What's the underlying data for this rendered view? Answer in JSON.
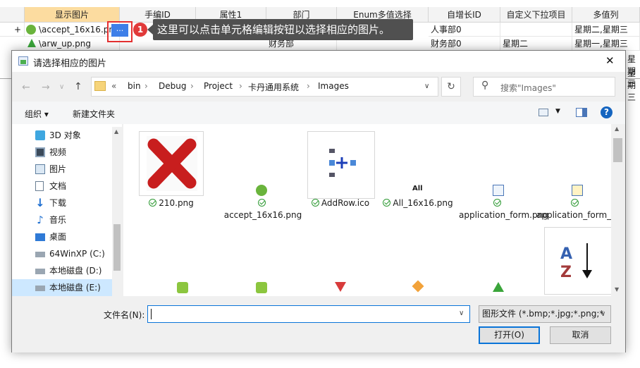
{
  "grid": {
    "headers": [
      "显示图片",
      "手编ID",
      "属性1",
      "部门",
      "Enum多值选择",
      "自增长ID",
      "自定义下拉项目",
      "多值列"
    ],
    "row1": {
      "image_value": "\\accept_16x16.png",
      "ellipsis": "...",
      "dept": "",
      "auto_id": "人事部0",
      "custom": "",
      "multi": "星期二,星期三"
    },
    "row2": {
      "image_value": "\\arw_up.png",
      "dept": "财务部",
      "auto_id": "财务部0",
      "custom": "星期二",
      "multi": "星期一,星期三"
    },
    "row_marker": "+",
    "right_edge": [
      "星期三",
      "星期三"
    ],
    "callout_number": "1",
    "callout_text": "这里可以点击单元格编辑按钮以选择相应的图片。"
  },
  "dialog": {
    "title": "请选择相应的图片",
    "close_symbol": "✕",
    "breadcrumb": {
      "prefix": "«",
      "items": [
        "bin",
        "Debug",
        "Project",
        "卡丹通用系统",
        "Images"
      ]
    },
    "search_placeholder": "搜索\"Images\"",
    "toolbar": {
      "organize": "组织 ▾",
      "new_folder": "新建文件夹"
    },
    "nav": [
      "3D 对象",
      "视频",
      "图片",
      "文档",
      "下载",
      "音乐",
      "桌面",
      "64WinXP  (C:)",
      "本地磁盘 (D:)",
      "本地磁盘 (E:)"
    ],
    "files": [
      {
        "name": "210.png"
      },
      {
        "name": "accept_16x16.png"
      },
      {
        "name": "AddRow.ico"
      },
      {
        "name": "All_16x16.png"
      },
      {
        "name": "application_form.png"
      },
      {
        "name": "application_form_edit.png"
      }
    ],
    "small_icon_text": "All",
    "filename_label": "文件名(N):",
    "filename_value": "",
    "filetype_value": "图形文件 (*.bmp;*.jpg;*.png;*",
    "open_button": "打开(O)",
    "cancel_button": "取消"
  },
  "colors": {
    "accent": "#0a74d8",
    "callout": "#e63131",
    "tooltip": "#505050",
    "header_selected": "#fcdca0",
    "nav_selected": "#cde8ff"
  }
}
